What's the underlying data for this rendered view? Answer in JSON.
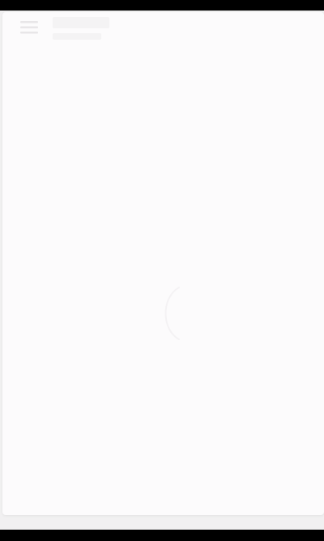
{
  "app": {
    "state": "loading",
    "header": {
      "logo_icon": "menu-icon"
    },
    "main": {
      "loader_icon": "spinner-icon"
    }
  },
  "colors": {
    "background": "#f1f0f1",
    "card": "#fcfbfc",
    "frame": "#000000",
    "icon": "#d8d6d8"
  }
}
